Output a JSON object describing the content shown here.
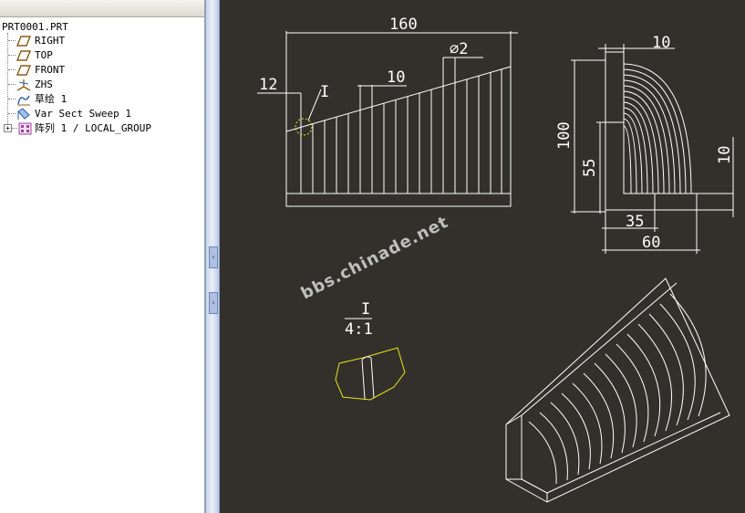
{
  "colors": {
    "canvas_bg": "#33302b",
    "drawing_line": "#ffffff",
    "highlight": "#e6e619",
    "datum_icon": "#8a5a1a",
    "sweep_icon": "#2a5fa8",
    "pattern_icon": "#a040a0"
  },
  "model_tree": {
    "root": "PRT0001.PRT",
    "items": [
      {
        "label": "RIGHT",
        "icon": "datum-plane-icon"
      },
      {
        "label": "TOP",
        "icon": "datum-plane-icon"
      },
      {
        "label": "FRONT",
        "icon": "datum-plane-icon"
      },
      {
        "label": "ZHS",
        "icon": "coordinate-system-icon"
      },
      {
        "label": "草绘 1",
        "icon": "sketch-icon"
      },
      {
        "label": "Var Sect Sweep 1",
        "icon": "sweep-icon"
      },
      {
        "label": "阵列 1 / LOCAL_GROUP",
        "icon": "pattern-icon",
        "expandable": true
      }
    ]
  },
  "splitter": {
    "collapse_glyph": "‹",
    "expand_glyph": "›"
  },
  "drawing": {
    "front_view": {
      "length": "160",
      "left_height": "12",
      "rib_spacing": "10",
      "rod_diameter": "∅2",
      "detail_callout": "I"
    },
    "side_view": {
      "top_thickness": "10",
      "total_height": "100",
      "inner_height": "55",
      "side_thickness": "10",
      "inner_width": "35",
      "total_width": "60"
    },
    "detail_view": {
      "label": "I",
      "scale": "4:1"
    },
    "watermark": "bbs.chinade.net"
  }
}
